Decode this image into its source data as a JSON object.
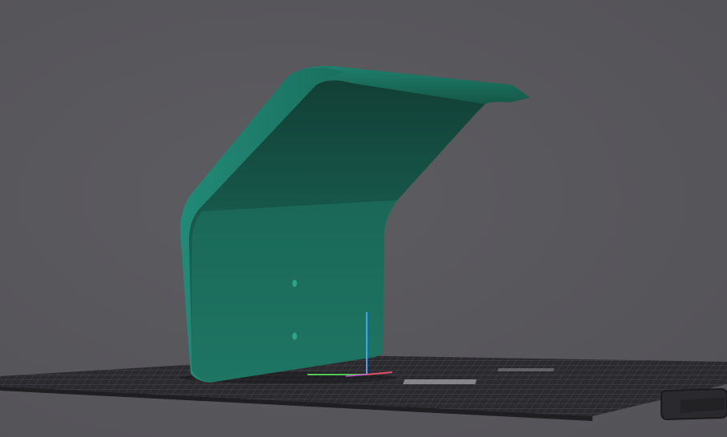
{
  "scene": {
    "model_color": "#1f7f6d",
    "model_shadow_color": "#164a40",
    "background_color": "#59585d",
    "bed_color": "#2f2f33",
    "bed_grid_color": "#4a4a50",
    "bed_label_text": "",
    "axes": {
      "x_color": "#e0506a",
      "y_color": "#55c955",
      "z_color": "#3ea2ff"
    }
  }
}
